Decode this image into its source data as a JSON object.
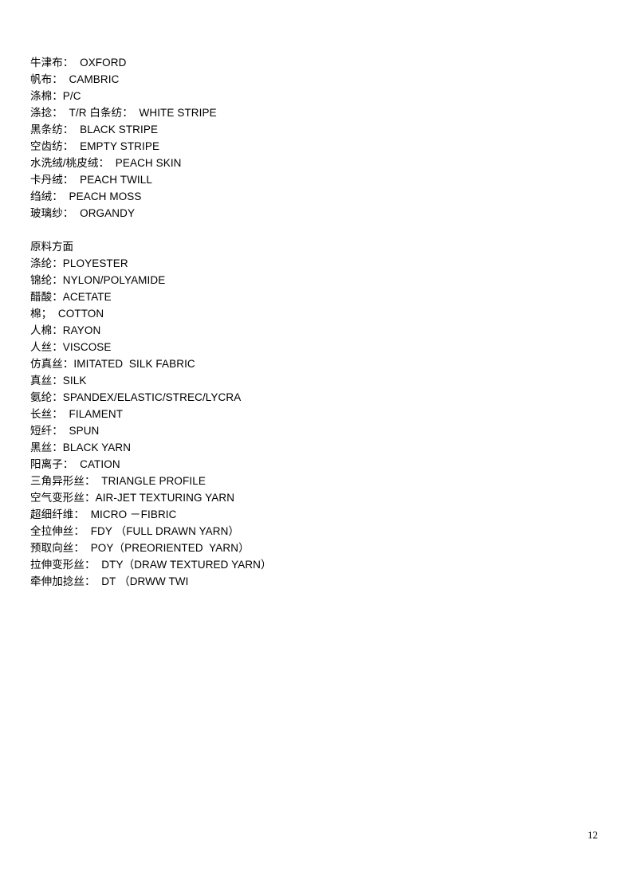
{
  "document": {
    "page_number": "12",
    "fabric_section": {
      "lines": [
        "牛津布：  OXFORD",
        "帆布：  CAMBRIC",
        "涤棉：P/C",
        "涤捻：  T/R 白条纺：  WHITE STRIPE",
        "黑条纺：  BLACK STRIPE",
        "空齿纺：  EMPTY STRIPE",
        "水洗绒/桃皮绒：  PEACH SKIN",
        "卡丹绒：  PEACH TWILL",
        "绉绒：  PEACH MOSS",
        "玻璃纱：  ORGANDY"
      ]
    },
    "material_section": {
      "heading": "原料方面",
      "lines": [
        "涤纶：PLOYESTER",
        "锦纶：NYLON/POLYAMIDE",
        "醋酸：ACETATE",
        "棉；  COTTON",
        "人棉：RAYON",
        "人丝：VISCOSE",
        "仿真丝：IMITATED  SILK FABRIC",
        "真丝：SILK",
        "氨纶：SPANDEX/ELASTIC/STREC/LYCRA",
        "长丝：  FILAMENT",
        "短纤：  SPUN",
        "黑丝：BLACK YARN",
        "阳离子：  CATION",
        "三角异形丝：  TRIANGLE PROFILE",
        "空气变形丝：AIR-JET TEXTURING YARN",
        "超细纤维：  MICRO －FIBRIC",
        "全拉伸丝：  FDY （FULL DRAWN YARN）",
        "预取向丝：  POY（PREORIENTED  YARN）",
        "拉伸变形丝：  DTY（DRAW TEXTURED YARN）",
        "牵伸加捻丝：  DT （DRWW TWI"
      ]
    }
  }
}
